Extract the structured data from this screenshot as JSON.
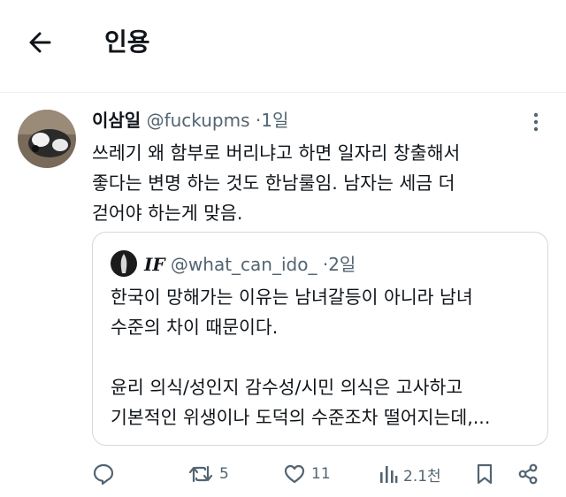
{
  "header": {
    "title": "인용"
  },
  "tweet": {
    "author_name": "이삼일",
    "handle": "@fuckupms",
    "separator": "·",
    "time": "1일",
    "text": "쓰레기 왜 함부로 버리냐고 하면 일자리 창출해서\n좋다는 변명 하는 것도 한남룰임. 남자는 세금 더\n걷어야 하는게 맞음."
  },
  "quote": {
    "author_name": "IF",
    "handle": "@what_can_ido_",
    "separator": "·",
    "time": "2일",
    "text": "한국이 망해가는 이유는 남녀갈등이 아니라 남녀\n수준의 차이 때문이다.\n\n윤리 의식/성인지 감수성/시민 의식은 고사하고\n기본적인 위생이나 도덕의 수준조차 떨어지는데,..."
  },
  "actions": {
    "reply_count": "",
    "retweet_count": "5",
    "like_count": "11",
    "view_count": "2.1천"
  },
  "icons": {
    "back": "arrow-left-icon",
    "more": "more-vertical-icon",
    "reply": "reply-icon",
    "retweet": "retweet-icon",
    "like": "heart-icon",
    "views": "views-icon",
    "bookmark": "bookmark-icon",
    "share": "share-icon"
  },
  "colors": {
    "text": "#0f1419",
    "secondary": "#536471",
    "border": "#cfd9de",
    "divider": "#eff3f4"
  }
}
